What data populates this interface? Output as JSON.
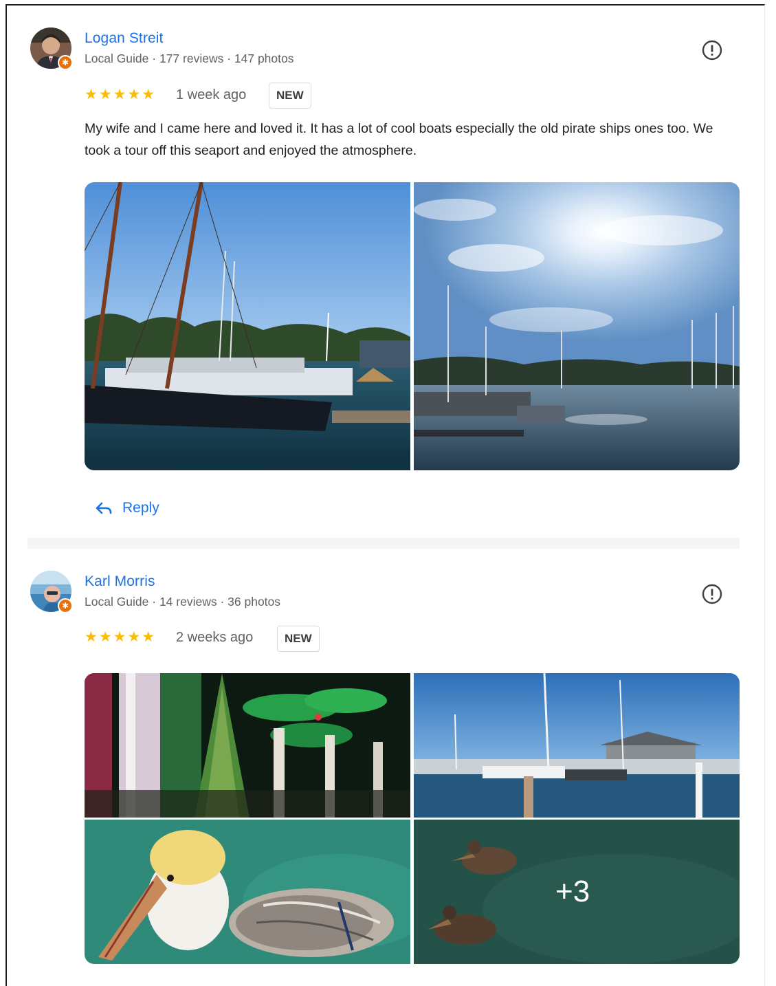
{
  "reviews": [
    {
      "name": "Logan Streit",
      "meta": "Local Guide · 177 reviews · 147 photos",
      "rating_stars": "★★★★★",
      "rating": 5,
      "when": "1 week ago",
      "badge": "NEW",
      "text": "My wife and I came here and loved it. It has a lot of cool boats especially the old pirate ships ones too. We took a tour off this seaport and enjoyed the atmosphere.",
      "reply_label": "Reply",
      "photo_count": 2
    },
    {
      "name": "Karl Morris",
      "meta": "Local Guide · 14 reviews · 36 photos",
      "rating_stars": "★★★★★",
      "rating": 5,
      "when": "2 weeks ago",
      "badge": "NEW",
      "more_photos": "+3",
      "photo_count": 4
    }
  ],
  "colors": {
    "link": "#1a73e8",
    "star": "#fbbc04",
    "secondary_text": "#5f6368",
    "guide_badge": "#e8710a"
  },
  "icons": {
    "flag": "report-flag-icon",
    "reply": "reply-arrow-icon",
    "guide": "local-guide-star-icon"
  }
}
